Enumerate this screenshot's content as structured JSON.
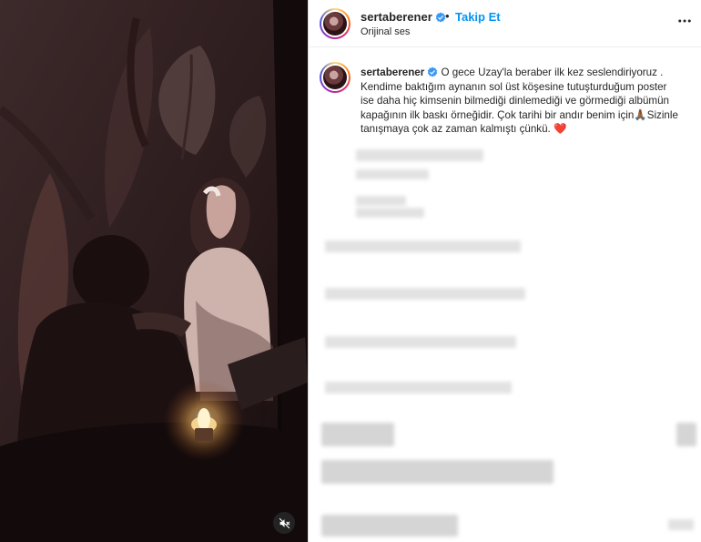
{
  "post": {
    "username": "sertaberener",
    "follow_label": "Takip Et",
    "separator": "•",
    "audio_label": "Orijinal ses",
    "caption_username": "sertaberener",
    "caption_text": "O gece Uzay'la beraber ilk kez seslendiriyoruz . Kendime baktığım aynanın sol üst köşesine tutuşturduğum poster ise daha hiç kimsenin bilmediği dinlemediği ve görmediği albümün kapağının ilk baskı örneğidir. Çok tarihi bir andır benim için🙏🏾Sizinle tanışmaya çok az zaman kalmıştı çünkü. ❤️"
  },
  "icons": {
    "verified": "verified-badge-icon",
    "more": "more-options-icon",
    "mute": "muted-speaker-icon"
  },
  "colors": {
    "link_blue": "#0095f6",
    "verified_blue": "#3897f0",
    "text": "#262626"
  }
}
